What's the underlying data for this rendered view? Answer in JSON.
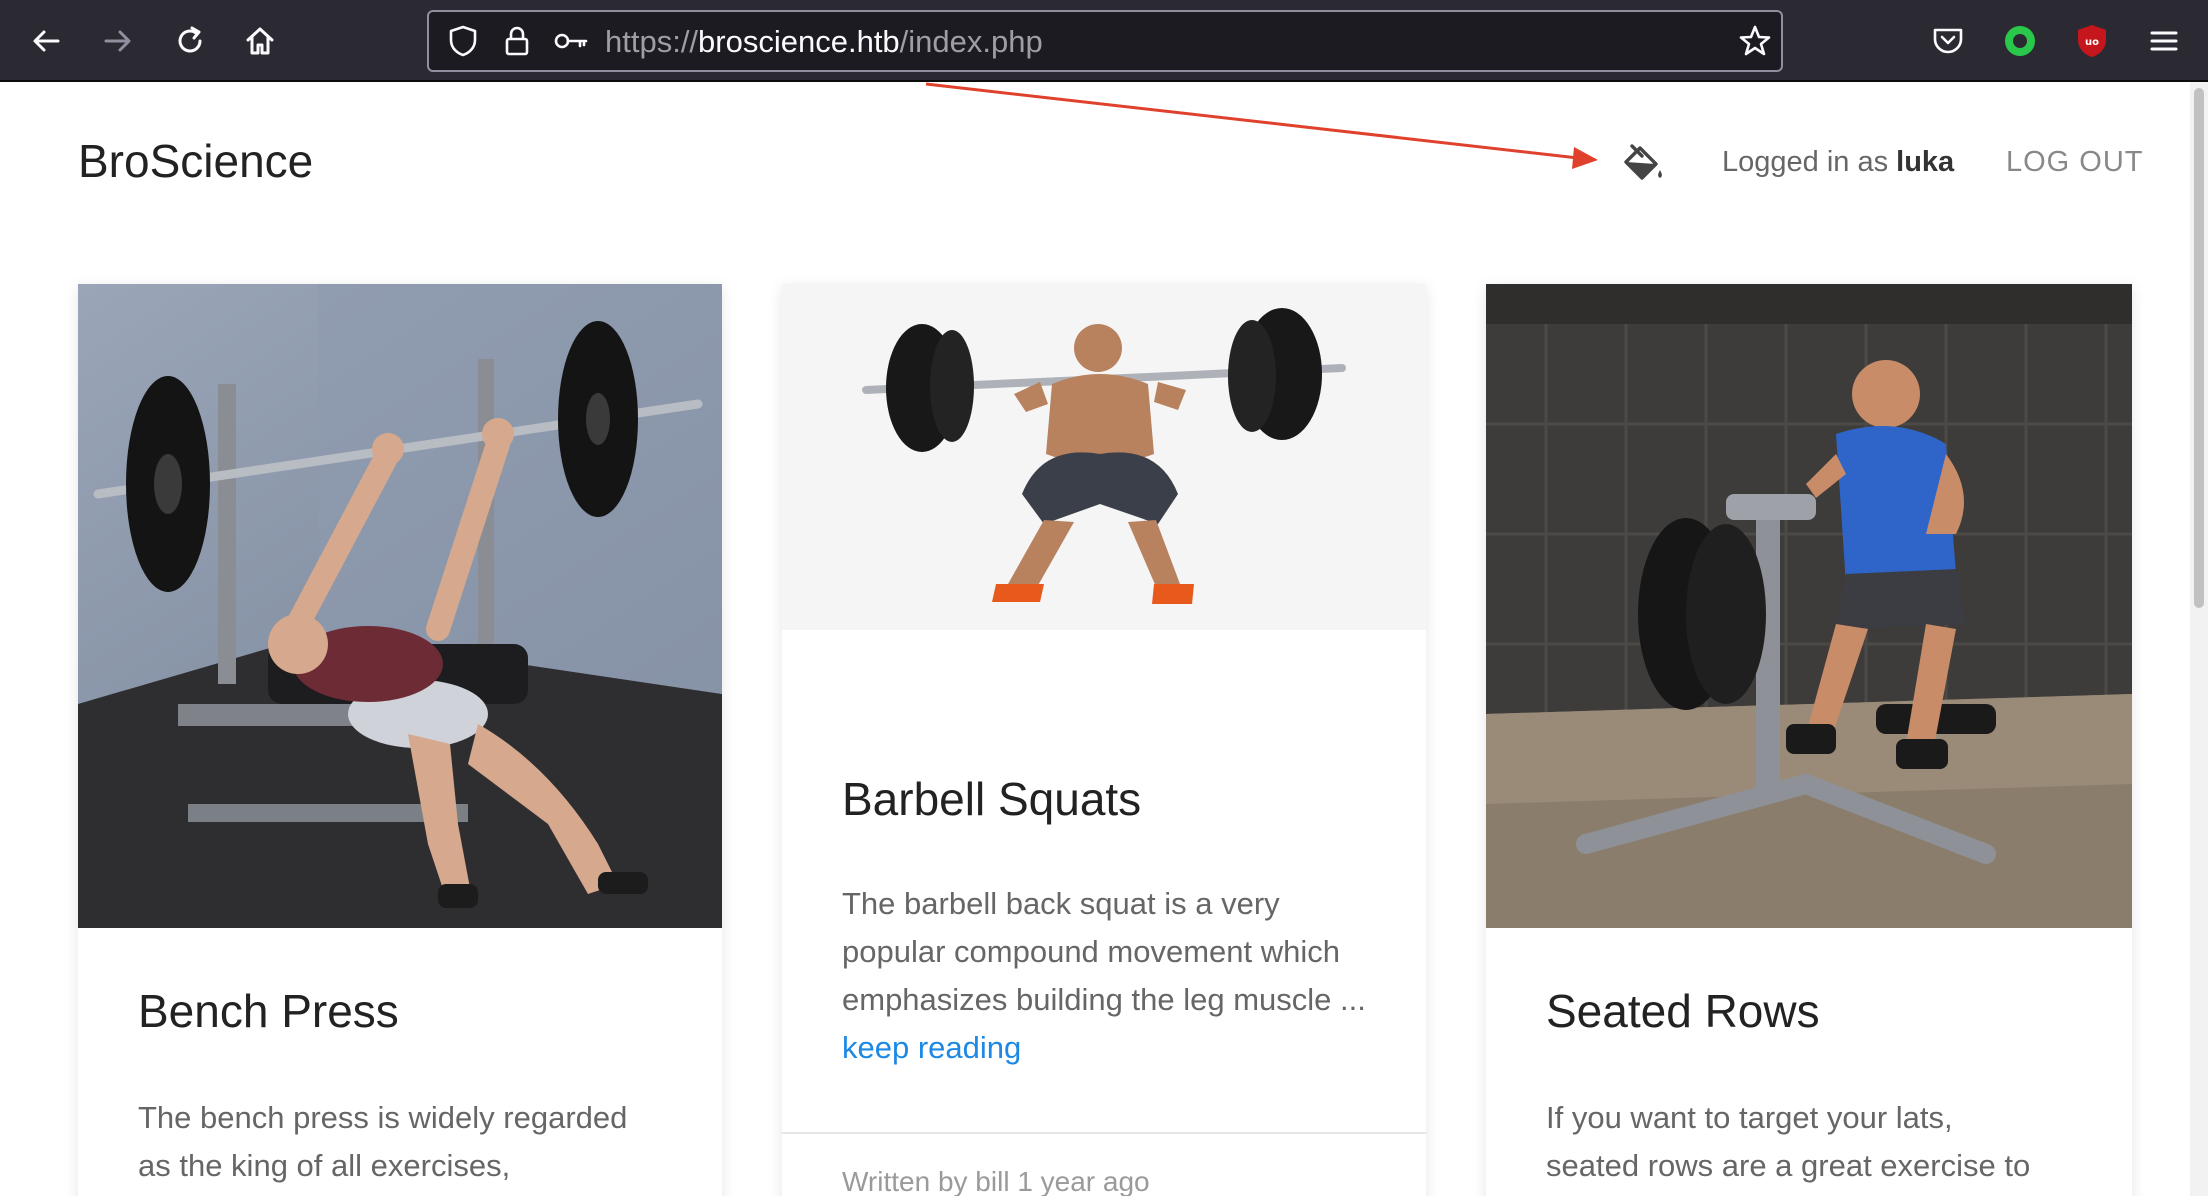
{
  "browser": {
    "url_scheme": "https://",
    "url_host": "broscience.htb",
    "url_path": "/index.php"
  },
  "site": {
    "brand": "BroScience",
    "logged_in_prefix": "Logged in as",
    "username": "luka",
    "logout_label": "LOG OUT"
  },
  "posts": [
    {
      "title": "Bench Press",
      "excerpt_line1": "The bench press is widely regarded",
      "excerpt_line2": "as the king of all exercises,"
    },
    {
      "title": "Barbell Squats",
      "excerpt": "The barbell back squat is a very popular compound movement which emphasizes building the leg muscle",
      "ellipsis": "...",
      "read_more": "keep reading",
      "footer": "Written by bill 1 year ago"
    },
    {
      "title": "Seated Rows",
      "excerpt_line1": "If you want to target your lats,",
      "excerpt_line2": "seated rows are a great exercise to"
    }
  ],
  "colors": {
    "toolbar": "#2b2a33",
    "urlbar": "#1c1b22",
    "link": "#1e88e5",
    "annotation_arrow": "#e0412c"
  }
}
